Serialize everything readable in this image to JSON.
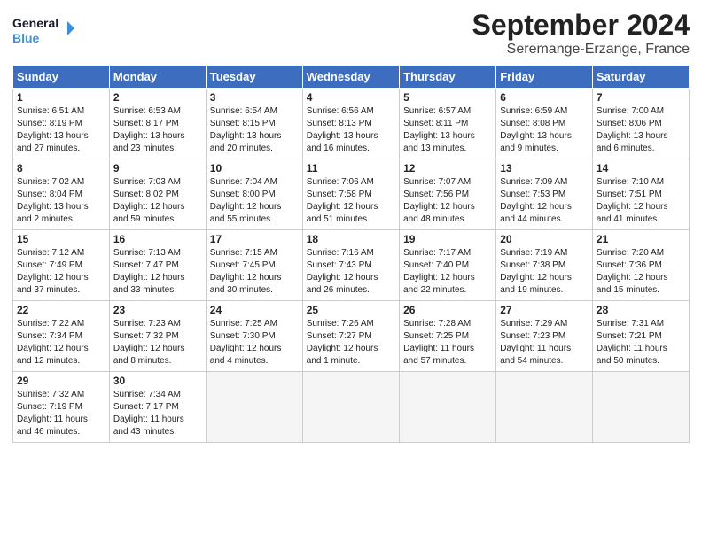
{
  "header": {
    "logo_line1": "General",
    "logo_line2": "Blue",
    "month": "September 2024",
    "location": "Seremange-Erzange, France"
  },
  "weekdays": [
    "Sunday",
    "Monday",
    "Tuesday",
    "Wednesday",
    "Thursday",
    "Friday",
    "Saturday"
  ],
  "days": [
    {
      "num": "",
      "info": ""
    },
    {
      "num": "",
      "info": ""
    },
    {
      "num": "",
      "info": ""
    },
    {
      "num": "",
      "info": ""
    },
    {
      "num": "",
      "info": ""
    },
    {
      "num": "",
      "info": ""
    },
    {
      "num": "1",
      "info": "Sunrise: 6:51 AM\nSunset: 8:19 PM\nDaylight: 13 hours\nand 27 minutes."
    },
    {
      "num": "2",
      "info": "Sunrise: 6:53 AM\nSunset: 8:17 PM\nDaylight: 13 hours\nand 23 minutes."
    },
    {
      "num": "3",
      "info": "Sunrise: 6:54 AM\nSunset: 8:15 PM\nDaylight: 13 hours\nand 20 minutes."
    },
    {
      "num": "4",
      "info": "Sunrise: 6:56 AM\nSunset: 8:13 PM\nDaylight: 13 hours\nand 16 minutes."
    },
    {
      "num": "5",
      "info": "Sunrise: 6:57 AM\nSunset: 8:11 PM\nDaylight: 13 hours\nand 13 minutes."
    },
    {
      "num": "6",
      "info": "Sunrise: 6:59 AM\nSunset: 8:08 PM\nDaylight: 13 hours\nand 9 minutes."
    },
    {
      "num": "7",
      "info": "Sunrise: 7:00 AM\nSunset: 8:06 PM\nDaylight: 13 hours\nand 6 minutes."
    },
    {
      "num": "8",
      "info": "Sunrise: 7:02 AM\nSunset: 8:04 PM\nDaylight: 13 hours\nand 2 minutes."
    },
    {
      "num": "9",
      "info": "Sunrise: 7:03 AM\nSunset: 8:02 PM\nDaylight: 12 hours\nand 59 minutes."
    },
    {
      "num": "10",
      "info": "Sunrise: 7:04 AM\nSunset: 8:00 PM\nDaylight: 12 hours\nand 55 minutes."
    },
    {
      "num": "11",
      "info": "Sunrise: 7:06 AM\nSunset: 7:58 PM\nDaylight: 12 hours\nand 51 minutes."
    },
    {
      "num": "12",
      "info": "Sunrise: 7:07 AM\nSunset: 7:56 PM\nDaylight: 12 hours\nand 48 minutes."
    },
    {
      "num": "13",
      "info": "Sunrise: 7:09 AM\nSunset: 7:53 PM\nDaylight: 12 hours\nand 44 minutes."
    },
    {
      "num": "14",
      "info": "Sunrise: 7:10 AM\nSunset: 7:51 PM\nDaylight: 12 hours\nand 41 minutes."
    },
    {
      "num": "15",
      "info": "Sunrise: 7:12 AM\nSunset: 7:49 PM\nDaylight: 12 hours\nand 37 minutes."
    },
    {
      "num": "16",
      "info": "Sunrise: 7:13 AM\nSunset: 7:47 PM\nDaylight: 12 hours\nand 33 minutes."
    },
    {
      "num": "17",
      "info": "Sunrise: 7:15 AM\nSunset: 7:45 PM\nDaylight: 12 hours\nand 30 minutes."
    },
    {
      "num": "18",
      "info": "Sunrise: 7:16 AM\nSunset: 7:43 PM\nDaylight: 12 hours\nand 26 minutes."
    },
    {
      "num": "19",
      "info": "Sunrise: 7:17 AM\nSunset: 7:40 PM\nDaylight: 12 hours\nand 22 minutes."
    },
    {
      "num": "20",
      "info": "Sunrise: 7:19 AM\nSunset: 7:38 PM\nDaylight: 12 hours\nand 19 minutes."
    },
    {
      "num": "21",
      "info": "Sunrise: 7:20 AM\nSunset: 7:36 PM\nDaylight: 12 hours\nand 15 minutes."
    },
    {
      "num": "22",
      "info": "Sunrise: 7:22 AM\nSunset: 7:34 PM\nDaylight: 12 hours\nand 12 minutes."
    },
    {
      "num": "23",
      "info": "Sunrise: 7:23 AM\nSunset: 7:32 PM\nDaylight: 12 hours\nand 8 minutes."
    },
    {
      "num": "24",
      "info": "Sunrise: 7:25 AM\nSunset: 7:30 PM\nDaylight: 12 hours\nand 4 minutes."
    },
    {
      "num": "25",
      "info": "Sunrise: 7:26 AM\nSunset: 7:27 PM\nDaylight: 12 hours\nand 1 minute."
    },
    {
      "num": "26",
      "info": "Sunrise: 7:28 AM\nSunset: 7:25 PM\nDaylight: 11 hours\nand 57 minutes."
    },
    {
      "num": "27",
      "info": "Sunrise: 7:29 AM\nSunset: 7:23 PM\nDaylight: 11 hours\nand 54 minutes."
    },
    {
      "num": "28",
      "info": "Sunrise: 7:31 AM\nSunset: 7:21 PM\nDaylight: 11 hours\nand 50 minutes."
    },
    {
      "num": "29",
      "info": "Sunrise: 7:32 AM\nSunset: 7:19 PM\nDaylight: 11 hours\nand 46 minutes."
    },
    {
      "num": "30",
      "info": "Sunrise: 7:34 AM\nSunset: 7:17 PM\nDaylight: 11 hours\nand 43 minutes."
    },
    {
      "num": "",
      "info": ""
    },
    {
      "num": "",
      "info": ""
    },
    {
      "num": "",
      "info": ""
    },
    {
      "num": "",
      "info": ""
    },
    {
      "num": "",
      "info": ""
    }
  ]
}
